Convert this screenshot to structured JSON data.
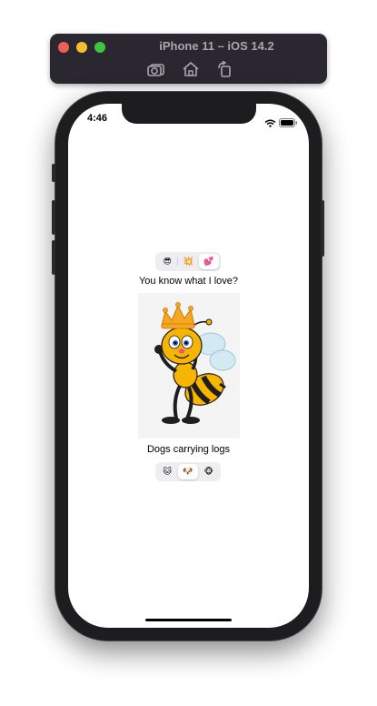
{
  "simulator": {
    "title": "iPhone 11 – iOS 14.2",
    "toolbar": [
      {
        "name": "screenshot-icon"
      },
      {
        "name": "home-icon"
      },
      {
        "name": "rotate-icon"
      }
    ]
  },
  "status_bar": {
    "time": "4:46",
    "icons": [
      "wifi-icon",
      "battery-icon"
    ]
  },
  "top_segment": {
    "items": [
      "😎",
      "💥",
      "💕"
    ],
    "selected_index": 2
  },
  "top_caption": "You know what I love?",
  "image": {
    "subject": "queen-bee-cartoon"
  },
  "bottom_caption": "Dogs carrying logs",
  "bottom_segment": {
    "items": [
      "🐱",
      "🐶",
      "🐵"
    ],
    "selected_index": 1
  },
  "colors": {
    "bee_yellow": "#f7b500",
    "bee_black": "#1e1e1e",
    "crown_gold": "#f5a623"
  }
}
